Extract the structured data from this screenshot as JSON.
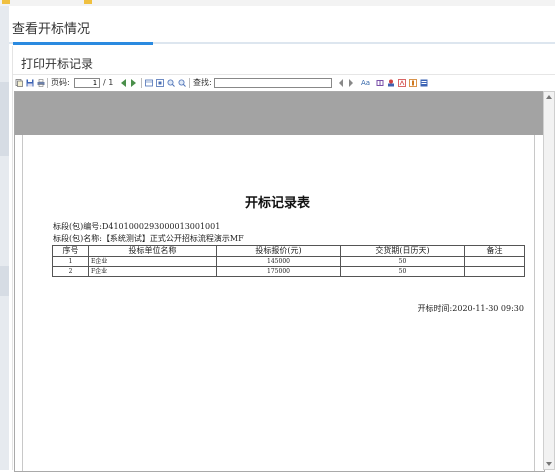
{
  "colors": {
    "accent": "#2a8ae0",
    "viewer_bg": "#a3a3a3",
    "bookmark_folder": "#f0c040"
  },
  "page": {
    "title": "查看开标情况"
  },
  "dialog": {
    "title": "打印开标记录"
  },
  "toolbar": {
    "page_label": "页码:",
    "page_value": "1",
    "page_total": "/ 1",
    "find_label": "查找:",
    "find_value": "",
    "icons": [
      "copy-icon",
      "save-icon",
      "print-icon",
      "first-page-icon",
      "prev-page-icon",
      "export-icon",
      "fit-page-icon",
      "zoom-in-icon",
      "zoom-out-icon",
      "find-prev-icon",
      "find-next-icon",
      "find-case-icon",
      "view-icon",
      "person-icon",
      "pdf-icon",
      "excel-icon",
      "word-icon"
    ]
  },
  "report": {
    "title": "开标记录表",
    "section_code_label": "标段(包)编号:",
    "section_code": "D4101000293000013001001",
    "section_name_label": "标段(包)名称:",
    "section_name": "【系统测试】正式公开招标流程演示MF",
    "columns": [
      "序号",
      "投标单位名称",
      "投标报价(元)",
      "交货期(日历天)",
      "备注"
    ],
    "rows": [
      {
        "no": "1",
        "bidder": "E企业",
        "price": "145000",
        "delivery": "50",
        "remark": ""
      },
      {
        "no": "2",
        "bidder": "F企业",
        "price": "175000",
        "delivery": "50",
        "remark": ""
      }
    ],
    "open_time_label": "开标时间:",
    "open_time": "2020-11-30 09:30"
  }
}
